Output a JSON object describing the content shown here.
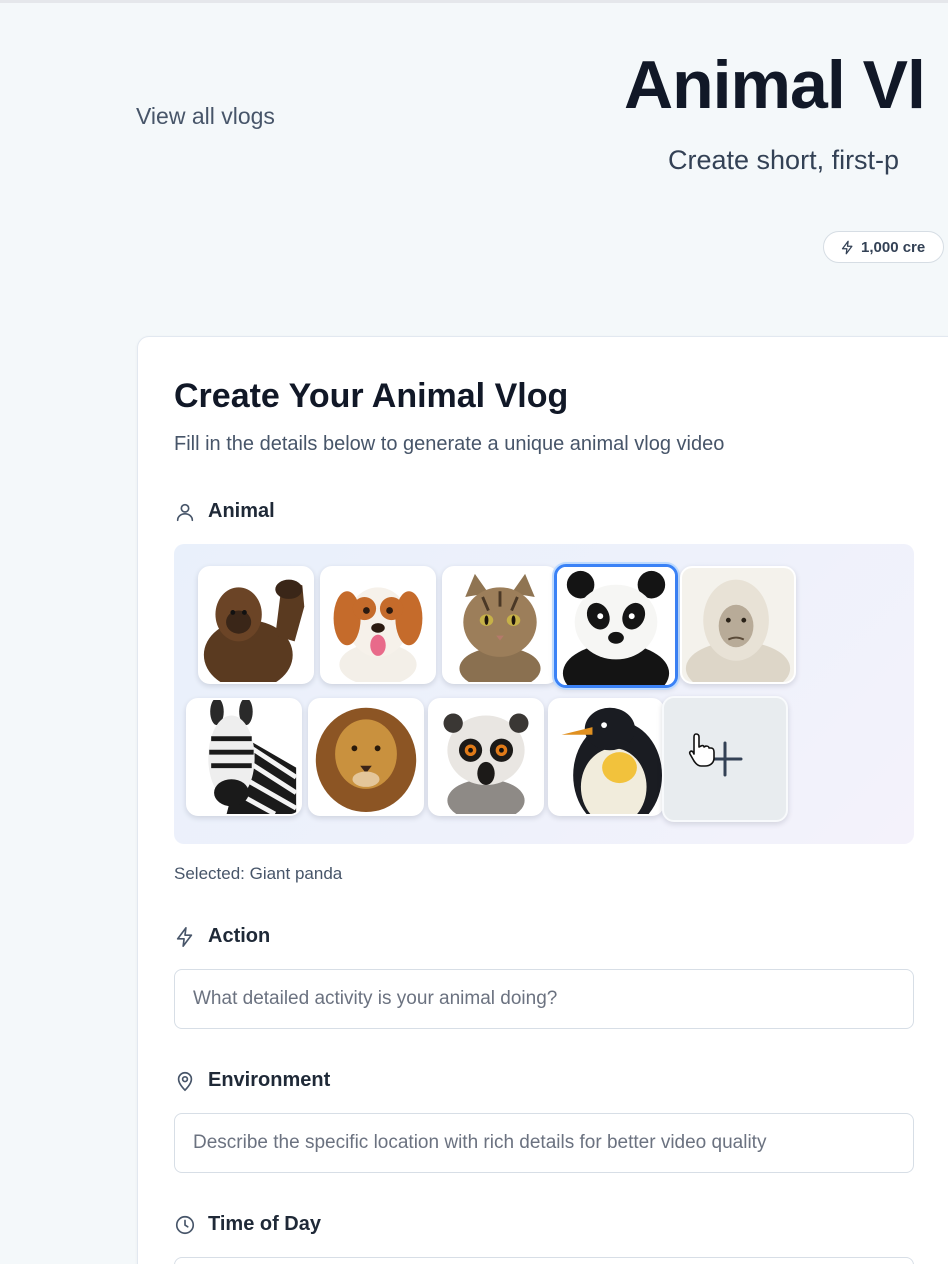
{
  "header": {
    "back_link": "View all vlogs",
    "title": "Animal Vl",
    "subtitle": "Create short, first-p",
    "credits": "1,000 cre"
  },
  "card": {
    "title": "Create Your Animal Vlog",
    "description": "Fill in the details below to generate a unique animal vlog video"
  },
  "animal_field": {
    "label": "Animal",
    "selected_text": "Selected: Giant panda",
    "animals": [
      {
        "name": "Gorilla",
        "icon": "gorilla"
      },
      {
        "name": "Dog",
        "icon": "dog"
      },
      {
        "name": "Cat",
        "icon": "cat"
      },
      {
        "name": "Giant panda",
        "icon": "panda",
        "selected": true
      },
      {
        "name": "Yeti",
        "icon": "yeti"
      },
      {
        "name": "Zebra",
        "icon": "zebra"
      },
      {
        "name": "Lion",
        "icon": "lion"
      },
      {
        "name": "Lemur",
        "icon": "lemur"
      },
      {
        "name": "Penguin",
        "icon": "penguin"
      }
    ],
    "add_icon": "plus-icon"
  },
  "action_field": {
    "label": "Action",
    "placeholder": "What detailed activity is your animal doing?",
    "value": ""
  },
  "environment_field": {
    "label": "Environment",
    "placeholder": "Describe the specific location with rich details for better video quality",
    "value": ""
  },
  "time_field": {
    "label": "Time of Day"
  },
  "colors": {
    "accent": "#3b82f6",
    "background": "#f4f8fa",
    "text_primary": "#111827",
    "text_muted": "#475569"
  }
}
